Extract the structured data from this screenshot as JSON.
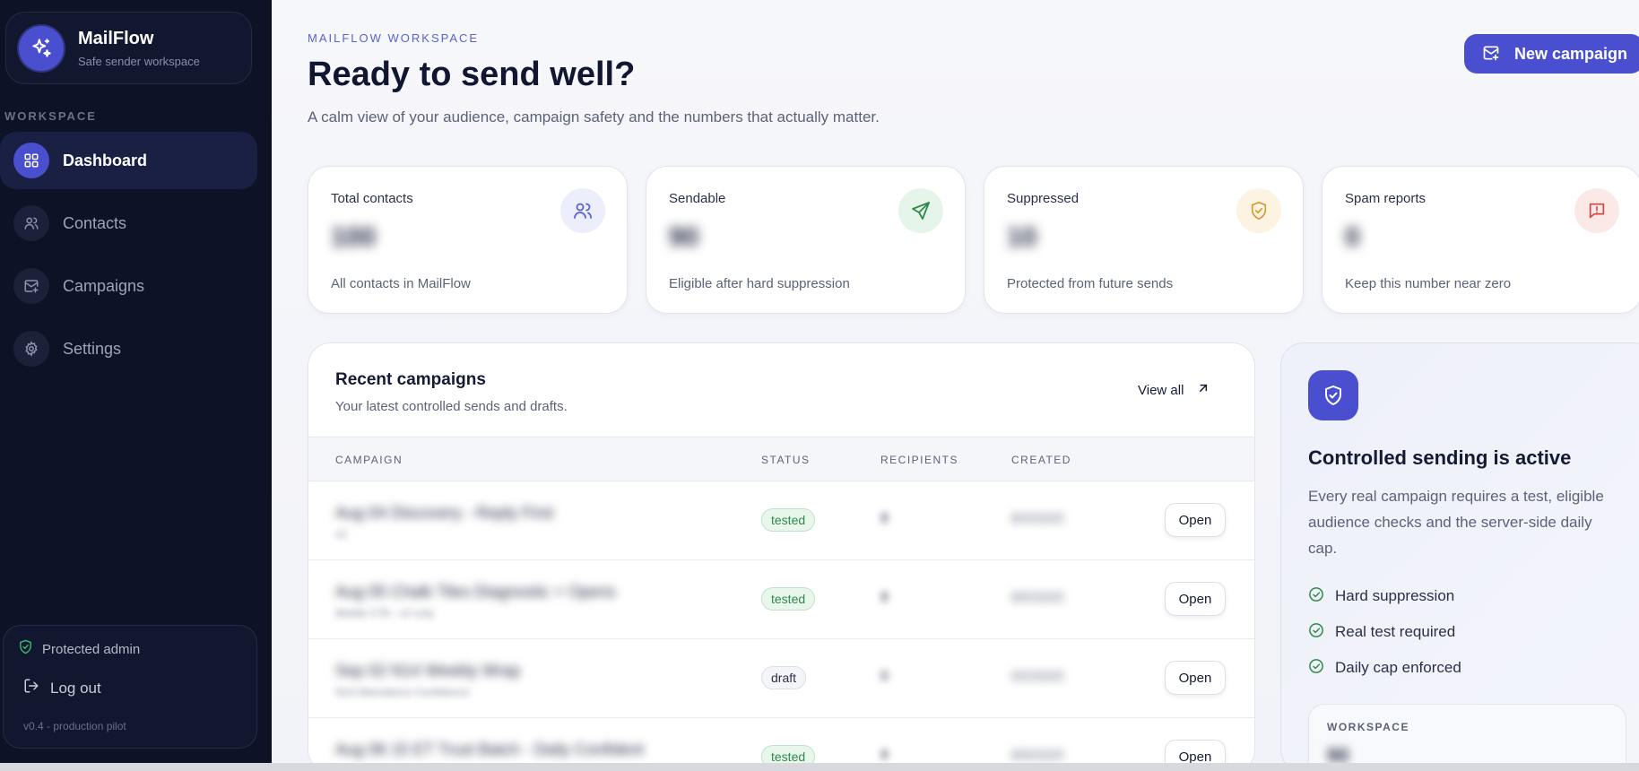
{
  "sidebar": {
    "brand": {
      "name": "MailFlow",
      "subtitle": "Safe sender workspace"
    },
    "section_label": "WORKSPACE",
    "items": [
      {
        "label": "Dashboard",
        "icon": "grid-icon",
        "active": true
      },
      {
        "label": "Contacts",
        "icon": "users-icon",
        "active": false
      },
      {
        "label": "Campaigns",
        "icon": "mail-plus-icon",
        "active": false
      },
      {
        "label": "Settings",
        "icon": "gear-icon",
        "active": false
      }
    ],
    "admin": {
      "label": "Protected admin",
      "logout": "Log out",
      "version": "v0.4 - production pilot"
    }
  },
  "header": {
    "eyebrow": "MAILFLOW WORKSPACE",
    "title": "Ready to send well?",
    "subtitle": "A calm view of your audience, campaign safety and the numbers that actually matter.",
    "new_campaign": "New campaign"
  },
  "stats": [
    {
      "title": "Total contacts",
      "value": "100",
      "desc": "All contacts in MailFlow",
      "icon": "users-icon",
      "accent": "#5b62cf"
    },
    {
      "title": "Sendable",
      "value": "90",
      "desc": "Eligible after hard suppression",
      "icon": "send-icon",
      "accent": "#2f8a4c"
    },
    {
      "title": "Suppressed",
      "value": "10",
      "desc": "Protected from future sends",
      "icon": "shield-icon",
      "accent": "#d9982e"
    },
    {
      "title": "Spam reports",
      "value": "0",
      "desc": "Keep this number near zero",
      "icon": "alert-icon",
      "accent": "#d9433c"
    }
  ],
  "campaigns": {
    "title": "Recent campaigns",
    "subtitle": "Your latest controlled sends and drafts.",
    "view_all": "View all",
    "columns": [
      "CAMPAIGN",
      "STATUS",
      "RECIPIENTS",
      "CREATED"
    ],
    "open_label": "Open",
    "rows": [
      {
        "name": "Aug 04 Discovery - Reply First",
        "meta": "v2",
        "status": "tested",
        "recipients": "8",
        "created": "8/4/2025"
      },
      {
        "name": "Aug 05 Chalk Tiles Diagnostic + Opens",
        "meta": "Mobile CTA - v2 only",
        "status": "tested",
        "recipients": "8",
        "created": "8/5/2025"
      },
      {
        "name": "Sep 02 N14 Weekly Wrap",
        "meta": "N14 Attendance Confidence",
        "status": "draft",
        "recipients": "0",
        "created": "9/2/2025"
      },
      {
        "name": "Aug 06 15 ET Trust Batch - Daily Confident",
        "meta": "",
        "status": "tested",
        "recipients": "8",
        "created": "8/6/2025"
      }
    ]
  },
  "safety": {
    "title": "Controlled sending is active",
    "text": "Every real campaign requires a test, eligible audience checks and the server-side daily cap.",
    "checks": [
      "Hard suppression",
      "Real test required",
      "Daily cap enforced"
    ],
    "workspace_label": "WORKSPACE",
    "workspace_value": "90"
  },
  "colors": {
    "primary": "#4a4fd0",
    "sidebar_bg": "#0d1227",
    "success": "#2f8a4c"
  }
}
